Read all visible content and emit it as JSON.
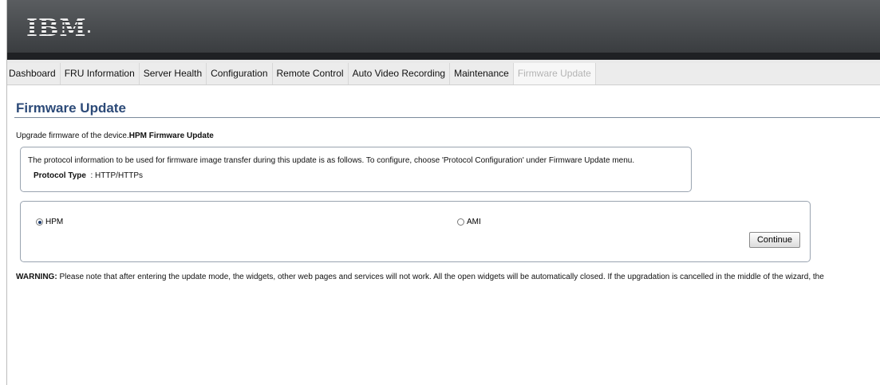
{
  "header": {
    "logo_text": "IBM"
  },
  "nav": {
    "items": [
      {
        "label": "Dashboard"
      },
      {
        "label": "FRU Information"
      },
      {
        "label": "Server Health"
      },
      {
        "label": "Configuration"
      },
      {
        "label": "Remote Control"
      },
      {
        "label": "Auto Video Recording"
      },
      {
        "label": "Maintenance"
      },
      {
        "label": "Firmware Update",
        "active": true
      }
    ]
  },
  "page": {
    "title": "Firmware Update",
    "subtitle_prefix": "Upgrade firmware of the device.",
    "subtitle_bold": "HPM Firmware Update"
  },
  "info_box": {
    "text": "The protocol information to be used for firmware image transfer during this update is as follows. To configure, choose 'Protocol Configuration' under Firmware Update menu.",
    "protocol_label": "Protocol Type",
    "protocol_value": ": HTTP/HTTPs"
  },
  "options": {
    "hpm_label": "HPM",
    "hpm_checked": true,
    "ami_label": "AMI",
    "ami_checked": false,
    "continue_label": "Continue"
  },
  "warning": {
    "label": "WARNING:",
    "text": " Please note that after entering the update mode, the widgets, other web pages and services will not work. All the open widgets will be automatically closed. If the upgradation is cancelled in the middle of the wizard, the"
  },
  "colors": {
    "title": "#2c4a78",
    "header_top": "#5a5d60",
    "header_bottom": "#3a3d40",
    "nav_bg": "#ececec",
    "active_tab_text": "#b4b4b4"
  }
}
